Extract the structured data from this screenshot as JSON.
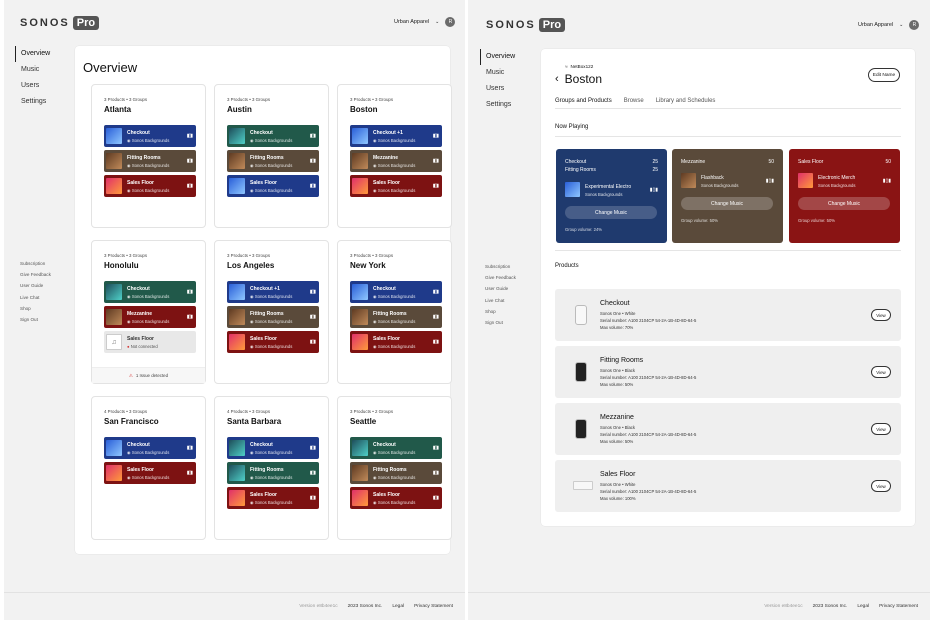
{
  "brand": {
    "name": "SONOS",
    "pro": "Pro"
  },
  "user": {
    "org": "Urban Apparel",
    "avatar": "R"
  },
  "nav": {
    "items": [
      "Overview",
      "Music",
      "Users",
      "Settings"
    ]
  },
  "subnav": {
    "items": [
      "Subscription",
      "Give Feedback",
      "User Guide",
      "Live Chat",
      "Shop",
      "Sign Out"
    ]
  },
  "footer": {
    "version": "Version e8b4ee1c",
    "copyright": "2023 Sonos Inc.",
    "legal": "Legal",
    "privacy": "Privacy Statement"
  },
  "overview": {
    "title": "Overview",
    "source": "Sonos Backgrounds",
    "locations": [
      {
        "meta": "3 Products • 3 Groups",
        "city": "Atlanta",
        "groups": [
          {
            "name": "Checkout",
            "color": "blue",
            "thumb": "blue"
          },
          {
            "name": "Fitting Rooms",
            "color": "brown",
            "thumb": "brown"
          },
          {
            "name": "Sales Floor",
            "color": "red",
            "thumb": "pink"
          }
        ]
      },
      {
        "meta": "3 Products • 3 Groups",
        "city": "Austin",
        "groups": [
          {
            "name": "Checkout",
            "color": "green",
            "thumb": "teal"
          },
          {
            "name": "Fitting Rooms",
            "color": "brown",
            "thumb": "brown"
          },
          {
            "name": "Sales Floor",
            "color": "blue",
            "thumb": "blue"
          }
        ]
      },
      {
        "meta": "3 Products • 3 Groups",
        "city": "Boston",
        "groups": [
          {
            "name": "Checkout +1",
            "color": "blue",
            "thumb": "blue"
          },
          {
            "name": "Mezzanine",
            "color": "brown",
            "thumb": "brown"
          },
          {
            "name": "Sales Floor",
            "color": "red",
            "thumb": "pink"
          }
        ]
      },
      {
        "meta": "3 Products • 3 Groups",
        "city": "Honolulu",
        "issue": "1 Issue detected",
        "groups": [
          {
            "name": "Checkout",
            "color": "green",
            "thumb": "teal"
          },
          {
            "name": "Mezzanine",
            "color": "red",
            "thumb": "brown"
          },
          {
            "name": "Sales Floor",
            "color": "gray",
            "thumb": "gray",
            "status": "Not connected"
          }
        ]
      },
      {
        "meta": "3 Products • 3 Groups",
        "city": "Los Angeles",
        "groups": [
          {
            "name": "Checkout +1",
            "color": "blue",
            "thumb": "blue"
          },
          {
            "name": "Fitting Rooms",
            "color": "brown",
            "thumb": "brown"
          },
          {
            "name": "Sales Floor",
            "color": "red",
            "thumb": "pink"
          }
        ]
      },
      {
        "meta": "3 Products • 3 Groups",
        "city": "New York",
        "groups": [
          {
            "name": "Checkout",
            "color": "blue",
            "thumb": "blue"
          },
          {
            "name": "Fitting Rooms",
            "color": "brown",
            "thumb": "brown"
          },
          {
            "name": "Sales Floor",
            "color": "red",
            "thumb": "pink"
          }
        ]
      },
      {
        "meta": "4 Products • 3 Groups",
        "city": "San Francisco",
        "groups": [
          {
            "name": "Checkout",
            "color": "blue",
            "thumb": "blue"
          },
          {
            "name": "Sales Floor",
            "color": "red",
            "thumb": "pink"
          }
        ]
      },
      {
        "meta": "4 Products • 3 Groups",
        "city": "Santa Barbara",
        "groups": [
          {
            "name": "Checkout",
            "color": "blue",
            "thumb": "teal"
          },
          {
            "name": "Fitting Rooms",
            "color": "green",
            "thumb": "teal"
          },
          {
            "name": "Sales Floor",
            "color": "red",
            "thumb": "pink"
          }
        ]
      },
      {
        "meta": "3 Products • 2 Groups",
        "city": "Seattle",
        "groups": [
          {
            "name": "Checkout",
            "color": "green",
            "thumb": "teal"
          },
          {
            "name": "Fitting Rooms",
            "color": "brown",
            "thumb": "brown"
          },
          {
            "name": "Sales Floor",
            "color": "red",
            "thumb": "pink"
          }
        ]
      }
    ]
  },
  "boston": {
    "network": "NetBox122",
    "title": "Boston",
    "edit_label": "Edit Name",
    "tabs": [
      "Groups and Products",
      "Browse",
      "Library and Schedules"
    ],
    "now_playing_label": "Now Playing",
    "change_label": "Change Music",
    "groups": [
      {
        "rows": [
          {
            "name": "Checkout",
            "vol": "25"
          },
          {
            "name": "Fitting Rooms",
            "vol": "25"
          }
        ],
        "artist": "Experimental Electro",
        "source": "Sonos Backgrounds",
        "volume": "Group volume: 24%",
        "color": "#1f3a6e"
      },
      {
        "rows": [
          {
            "name": "Mezzanine",
            "vol": "50"
          }
        ],
        "artist": "Flashback",
        "source": "Sonos Backgrounds",
        "volume": "Group volume: 50%",
        "color": "#5a4a3a"
      },
      {
        "rows": [
          {
            "name": "Sales Floor",
            "vol": "50"
          }
        ],
        "artist": "Electronic Merch",
        "source": "Sonos Backgrounds",
        "volume": "Group volume: 50%",
        "color": "#8a1414"
      }
    ],
    "products_label": "Products",
    "view_label": "View",
    "products": [
      {
        "name": "Checkout",
        "model": "Sonos One • White",
        "serial": "Serial number: A100 2104CP 54-2A-1B-4D-8D-64-5",
        "volume": "Max volume: 70%",
        "speaker": "white"
      },
      {
        "name": "Fitting Rooms",
        "model": "Sonos One • Black",
        "serial": "Serial number: A100 2104CP 54-2A-1B-4D-8D-64-5",
        "volume": "Max volume: 50%",
        "speaker": "black"
      },
      {
        "name": "Mezzanine",
        "model": "Sonos One • Black",
        "serial": "Serial number: A100 2104CP 54-2A-1B-4D-8D-64-5",
        "volume": "Max volume: 50%",
        "speaker": "black"
      },
      {
        "name": "Sales Floor",
        "model": "Sonos One • White",
        "serial": "Serial number: A100 2104CP 54-2A-1B-4D-8D-64-5",
        "volume": "Max volume: 100%",
        "speaker": "soundbar"
      }
    ]
  }
}
